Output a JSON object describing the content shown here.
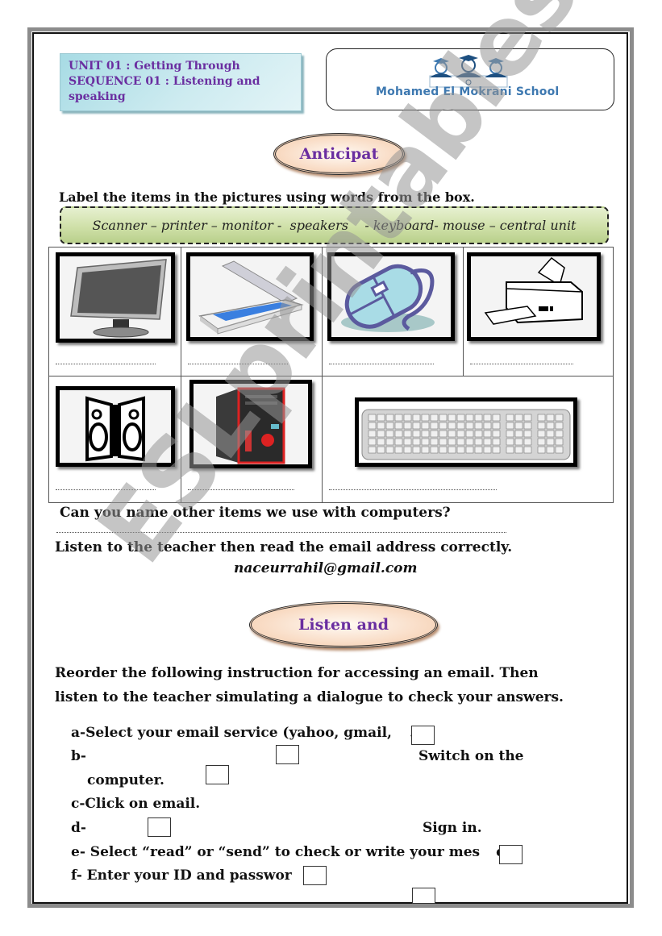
{
  "header": {
    "unit_line": "UNIT 01 : Getting Through",
    "sequence_line": "SEQUENCE 01 : Listening and",
    "sequence_line2": "speaking",
    "school_name": "Mohamed El Mokrani School",
    "logo_icon": "graduates-laptop-logo"
  },
  "section1": {
    "badge": "Anticipat",
    "instruction": "Label the items in the pictures using words from the box.",
    "word_box": "Scanner – printer – monitor -  speakers    - keyboard- mouse – central unit",
    "pictures": [
      {
        "icon": "monitor-icon",
        "answer": ""
      },
      {
        "icon": "scanner-icon",
        "answer": ""
      },
      {
        "icon": "mouse-icon",
        "answer": ""
      },
      {
        "icon": "printer-icon",
        "answer": ""
      },
      {
        "icon": "speakers-icon",
        "answer": ""
      },
      {
        "icon": "central-unit-icon",
        "answer": ""
      },
      {
        "icon": "keyboard-icon",
        "answer": ""
      }
    ],
    "question": "Can you name other items we use with computers?",
    "listen_instruction": "Listen to the teacher then read the email address correctly.",
    "email": "naceurrahil@gmail.com"
  },
  "section2": {
    "badge": "Listen and",
    "instruction_line1": "Reorder the following instruction for accessing an email. Then",
    "instruction_line2": "listen to the   teacher simulating a  dialogue to check your answers.",
    "items": {
      "a": "a-Select your email service (yahoo, gmail,",
      "a_tail": ".)",
      "b": "b-",
      "b_text": "Switch on the",
      "b_cont": "computer.",
      "c": "c-Click on email.",
      "d": "d-",
      "d_text": "Sign in.",
      "e": "e-  Select “read” or “send” to check or write your mes",
      "e_tail": "es.",
      "f": "f- Enter your ID and passwor"
    }
  },
  "watermark": "ESLprintables.com"
}
